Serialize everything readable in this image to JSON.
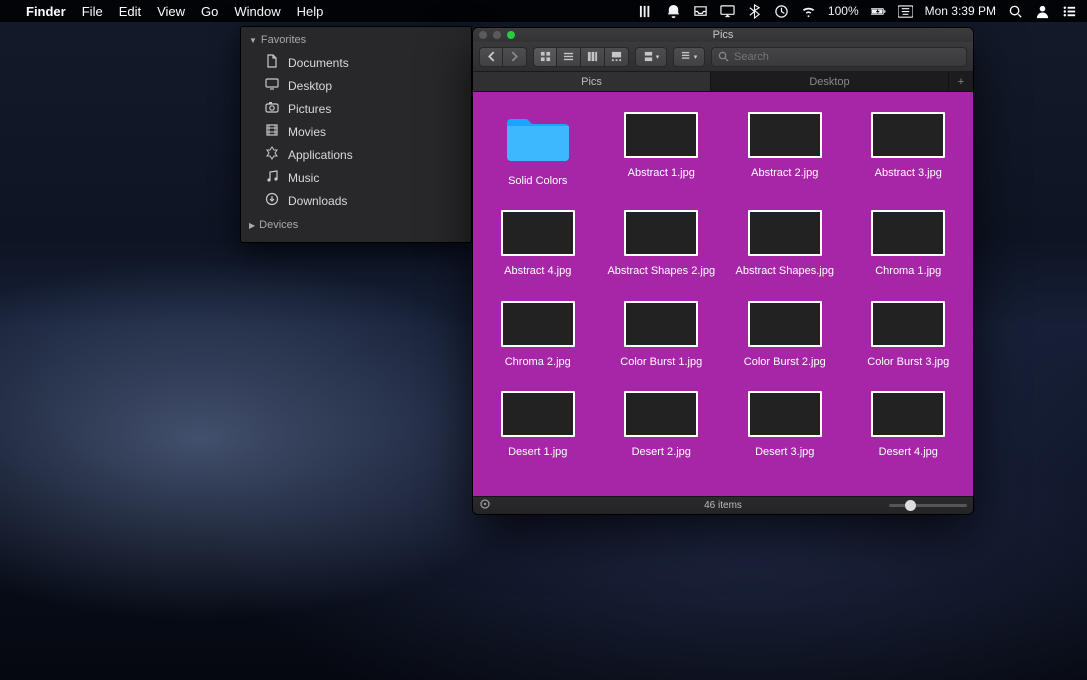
{
  "menubar": {
    "app": "Finder",
    "menus": [
      "File",
      "Edit",
      "View",
      "Go",
      "Window",
      "Help"
    ],
    "battery": "100%",
    "clock": "Mon 3:39 PM"
  },
  "favorites": {
    "section1": "Favorites",
    "section2": "Devices",
    "items": [
      {
        "label": "Documents",
        "icon": "doc"
      },
      {
        "label": "Desktop",
        "icon": "desktop"
      },
      {
        "label": "Pictures",
        "icon": "camera"
      },
      {
        "label": "Movies",
        "icon": "film"
      },
      {
        "label": "Applications",
        "icon": "apps"
      },
      {
        "label": "Music",
        "icon": "music"
      },
      {
        "label": "Downloads",
        "icon": "download"
      }
    ]
  },
  "finder": {
    "title": "Pics",
    "search_placeholder": "Search",
    "tabs": [
      {
        "label": "Pics",
        "active": true
      },
      {
        "label": "Desktop",
        "active": false
      }
    ],
    "status": "46 items",
    "files": [
      {
        "name": "Solid Colors",
        "kind": "folder"
      },
      {
        "name": "Abstract 1.jpg",
        "art": "art-abs1"
      },
      {
        "name": "Abstract 2.jpg",
        "art": "art-abs2"
      },
      {
        "name": "Abstract 3.jpg",
        "art": "art-abs3"
      },
      {
        "name": "Abstract 4.jpg",
        "art": "art-abs4"
      },
      {
        "name": "Abstract Shapes 2.jpg",
        "art": "art-absS2"
      },
      {
        "name": "Abstract Shapes.jpg",
        "art": "art-absS"
      },
      {
        "name": "Chroma 1.jpg",
        "art": "art-chr1"
      },
      {
        "name": "Chroma 2.jpg",
        "art": "art-chr2"
      },
      {
        "name": "Color Burst 1.jpg",
        "art": "art-cb1"
      },
      {
        "name": "Color Burst 2.jpg",
        "art": "art-cb2"
      },
      {
        "name": "Color Burst 3.jpg",
        "art": "art-cb3"
      },
      {
        "name": "Desert 1.jpg",
        "art": "art-des1"
      },
      {
        "name": "Desert 2.jpg",
        "art": "art-des2"
      },
      {
        "name": "Desert 3.jpg",
        "art": "art-des3"
      },
      {
        "name": "Desert 4.jpg",
        "art": "art-des4"
      }
    ]
  }
}
